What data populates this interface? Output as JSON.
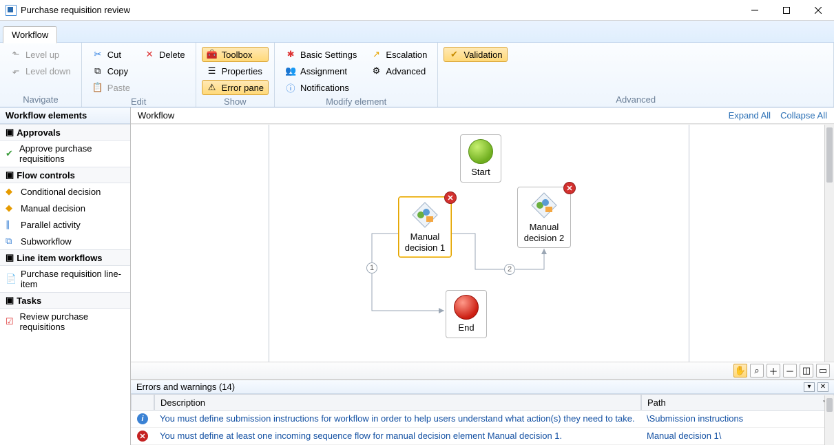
{
  "window": {
    "title": "Purchase requisition review"
  },
  "tab": {
    "label": "Workflow"
  },
  "ribbon": {
    "navigate": {
      "level_up": "Level up",
      "level_down": "Level down",
      "group": "Navigate"
    },
    "edit": {
      "cut": "Cut",
      "delete": "Delete",
      "copy": "Copy",
      "paste": "Paste",
      "group": "Edit"
    },
    "show": {
      "toolbox": "Toolbox",
      "properties": "Properties",
      "error_pane": "Error pane",
      "group": "Show"
    },
    "modify": {
      "basic": "Basic Settings",
      "assignment": "Assignment",
      "notifications": "Notifications",
      "escalation": "Escalation",
      "advanced": "Advanced",
      "group": "Modify element"
    },
    "advanced": {
      "validation": "Validation",
      "group": "Advanced"
    }
  },
  "toolbox": {
    "title": "Workflow elements",
    "categories": [
      {
        "label": "Approvals",
        "items": [
          {
            "label": "Approve purchase requisitions"
          }
        ]
      },
      {
        "label": "Flow controls",
        "items": [
          {
            "label": "Conditional decision"
          },
          {
            "label": "Manual decision"
          },
          {
            "label": "Parallel activity"
          },
          {
            "label": "Subworkflow"
          }
        ]
      },
      {
        "label": "Line item workflows",
        "items": [
          {
            "label": "Purchase requisition line-item"
          }
        ]
      },
      {
        "label": "Tasks",
        "items": [
          {
            "label": "Review purchase requisitions"
          }
        ]
      }
    ]
  },
  "canvas": {
    "title": "Workflow",
    "expand_all": "Expand All",
    "collapse_all": "Collapse All",
    "nodes": {
      "start": "Start",
      "md1": "Manual\ndecision 1",
      "md2": "Manual\ndecision 2",
      "end": "End"
    },
    "connectors": {
      "c1": "1",
      "c2": "2"
    }
  },
  "errors": {
    "title": "Errors and warnings (14)",
    "col_desc": "Description",
    "col_path": "Path",
    "rows": [
      {
        "type": "info",
        "desc": "You must define submission instructions for workflow  in order to help users understand what action(s) they need to take.",
        "path": "\\Submission instructions"
      },
      {
        "type": "error",
        "desc": "You must define at least one incoming sequence flow for manual decision element Manual decision 1.",
        "path": "Manual decision 1\\"
      }
    ]
  }
}
